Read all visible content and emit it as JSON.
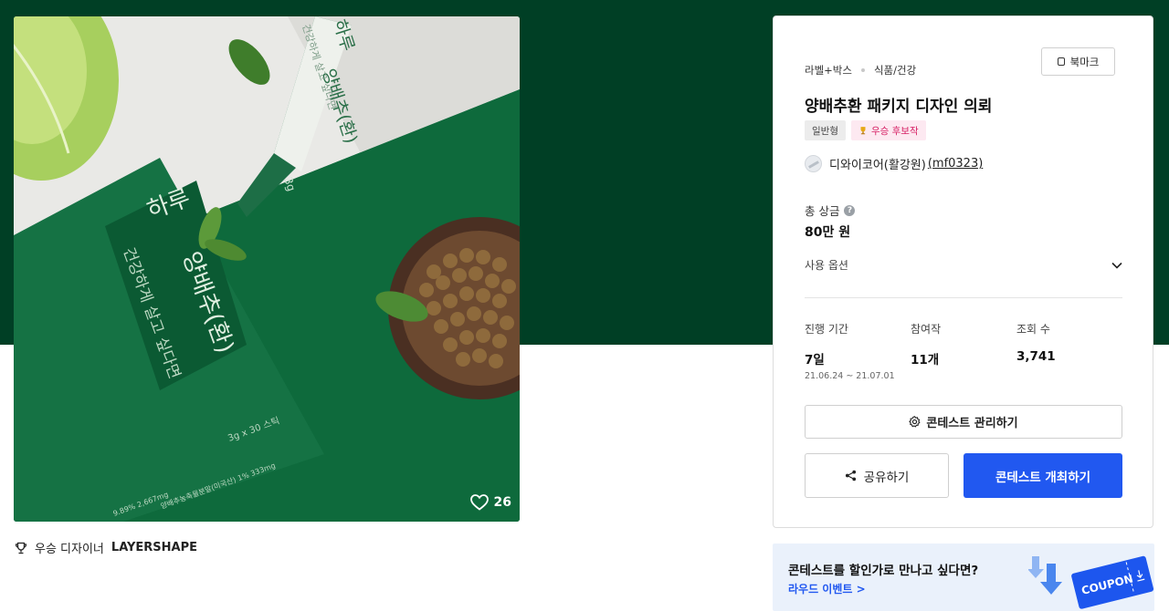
{
  "product": {
    "likes": "26",
    "winner_prefix": "우승 디자이너",
    "winner_name": "LAYERSHAPE",
    "image_text": {
      "box_title_1": "하루",
      "box_title_2": "양배추(환)",
      "box_subtitle": "건강하게 살고 싶다면",
      "box_spec": "3g x 30 스틱",
      "box_ingredients": "양배추농축물분말(미국산) 1% 333mg",
      "box_partial": "9.89% 2,667mg",
      "stick_title_1": "하루",
      "stick_title_2": "양배추(환)",
      "stick_subtitle": "건강하게 살고 싶다면",
      "stick_weight": "3g"
    }
  },
  "card": {
    "category_1": "라벨+박스",
    "category_2": "식품/건강",
    "bookmark_label": "북마크",
    "title": "양배추환 패키지 디자인 의뢰",
    "tag_general": "일반형",
    "tag_winner": "우승 후보작",
    "host_name": "디와이코어(활강원)",
    "host_id": "(mf0323)",
    "prize_label": "총 상금",
    "prize_value": "80만 원",
    "usage_label": "사용 옵션",
    "stats": {
      "period_label": "진행 기간",
      "period_value": "7일",
      "period_dates": "21.06.24 ~ 21.07.01",
      "entries_label": "참여작",
      "entries_value": "11개",
      "views_label": "조회 수",
      "views_value": "3,741"
    },
    "manage_label": "콘테스트 관리하기",
    "share_label": "공유하기",
    "open_label": "콘테스트 개최하기"
  },
  "coupon": {
    "text": "콘테스트를 할인가로 만나고 싶다면?",
    "link": "라우드 이벤트 >",
    "ticket_text": "COUPON"
  },
  "colors": {
    "hero_green": "#003f25",
    "accent_blue": "#2158f0",
    "winner_pink": "#d61e63"
  }
}
